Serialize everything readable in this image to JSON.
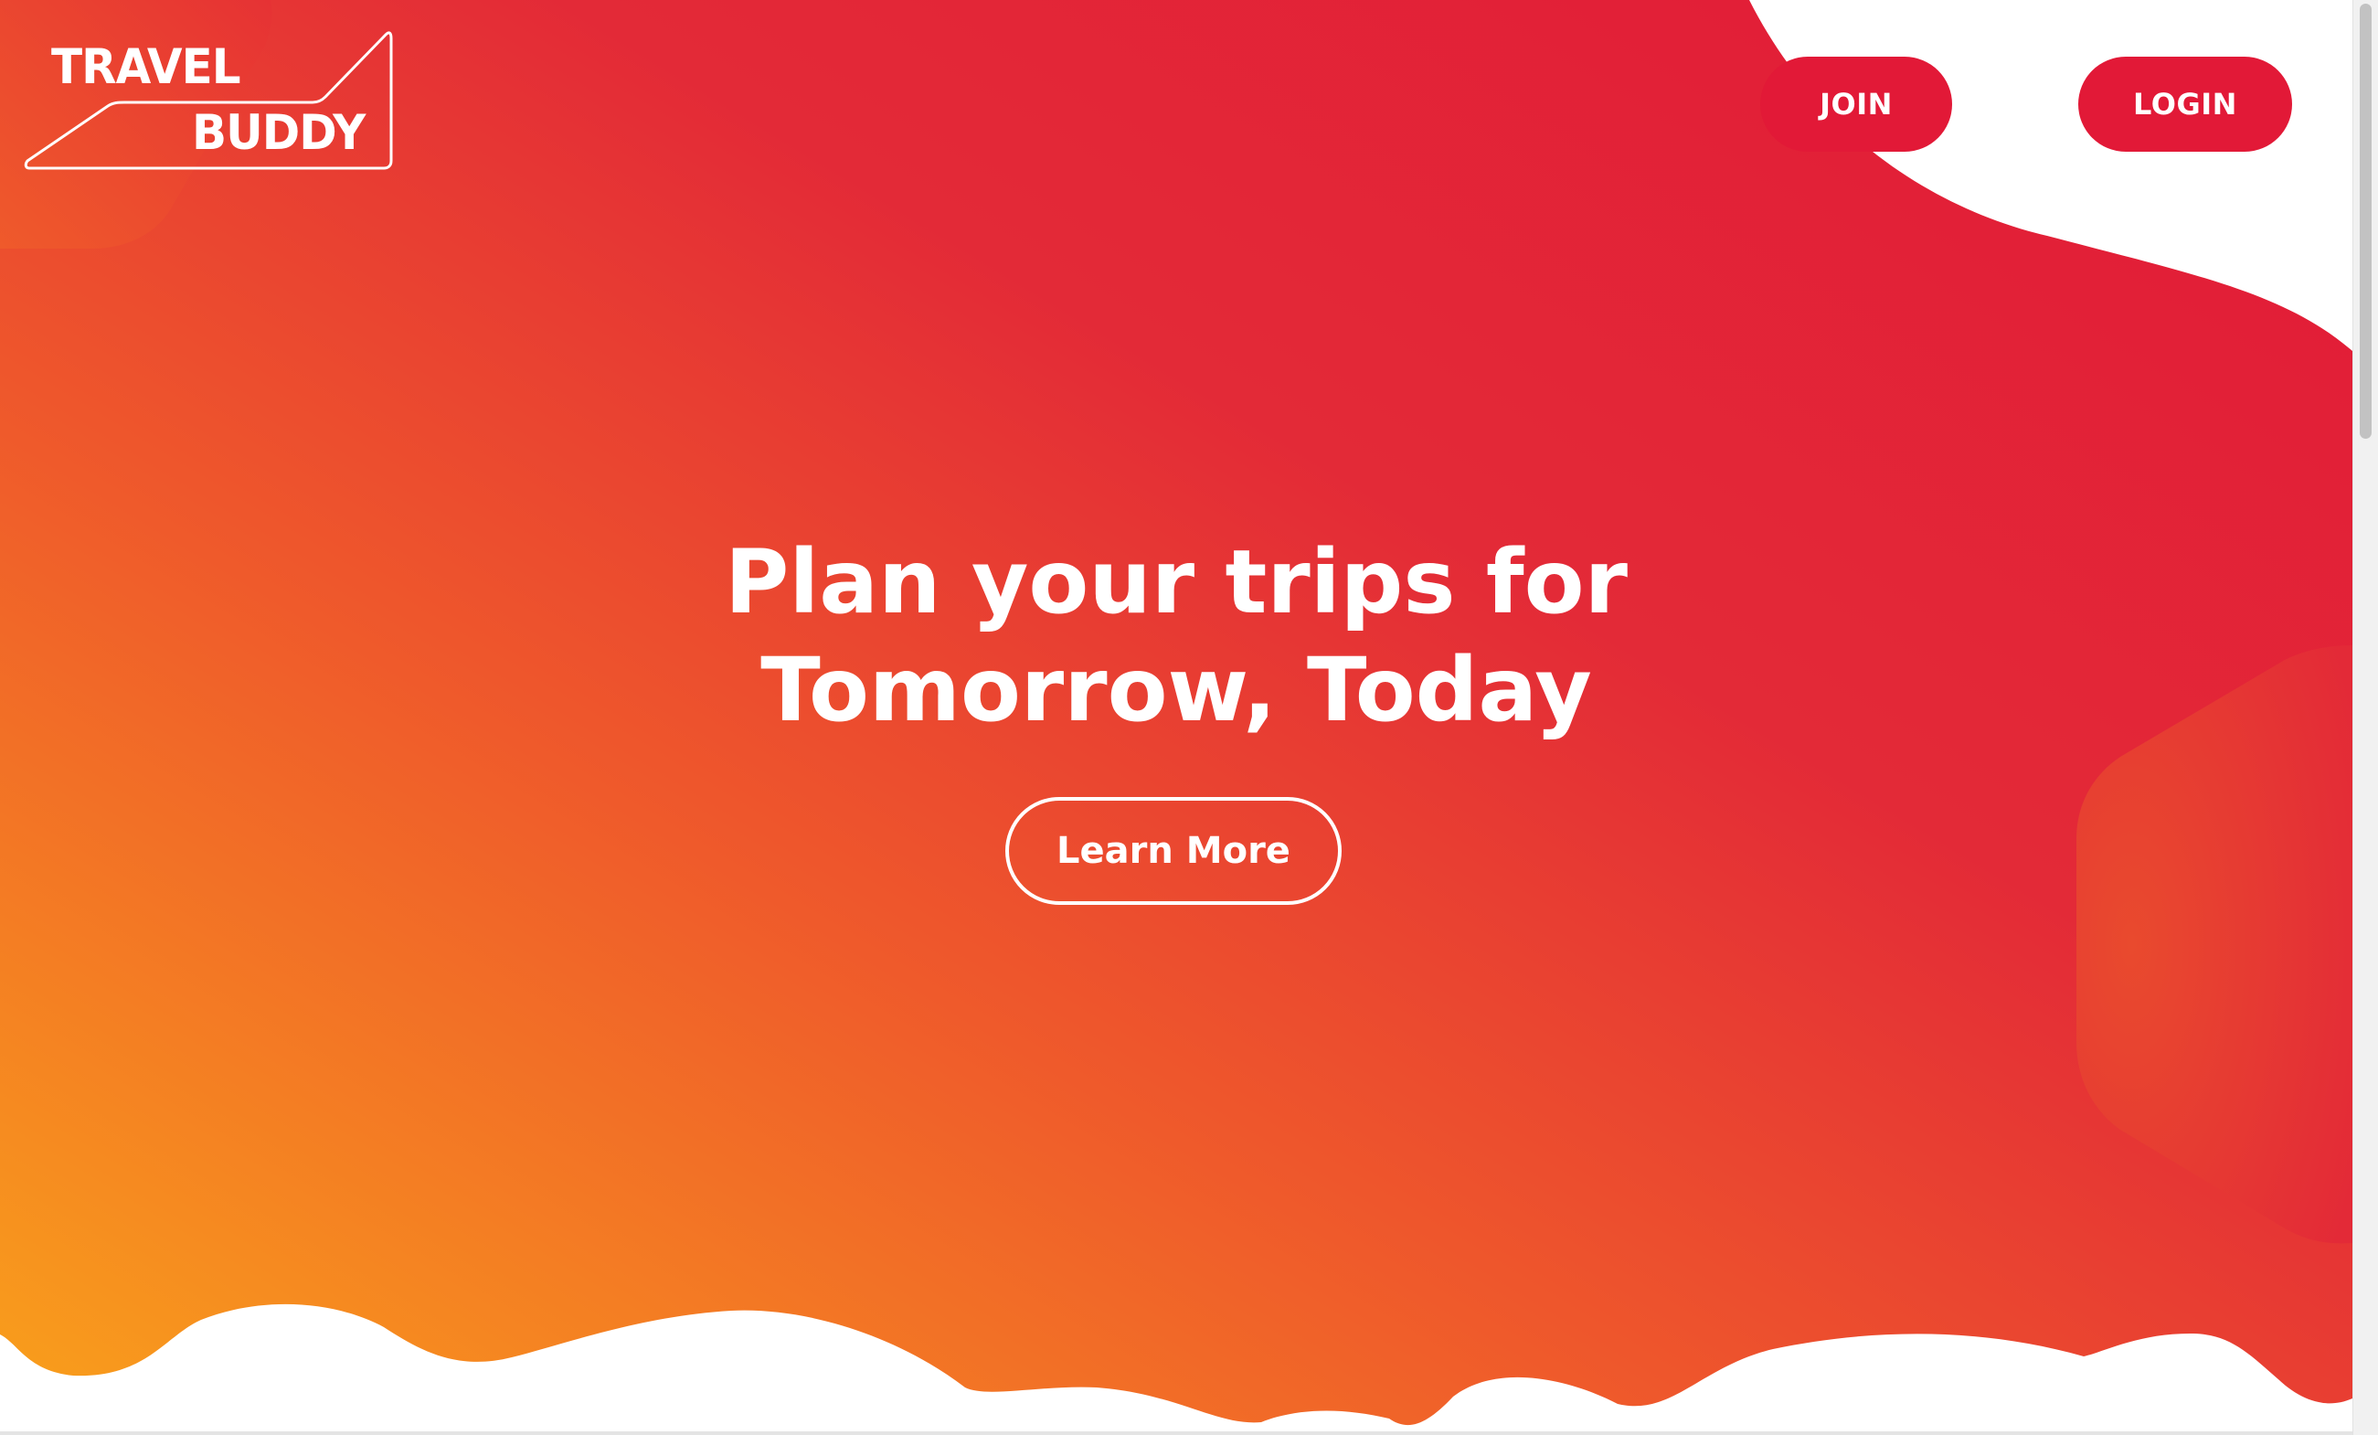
{
  "brand": {
    "logo_top": "TRAVEL",
    "logo_bottom": "BUDDY"
  },
  "nav": {
    "join_label": "JOIN",
    "login_label": "LOGIN"
  },
  "hero": {
    "headline_line1": "Plan your trips for",
    "headline_line2": "Tomorrow, Today",
    "cta_label": "Learn More"
  },
  "colors": {
    "primary_red": "#e21937",
    "accent_orange": "#f9a11b",
    "white": "#ffffff"
  }
}
